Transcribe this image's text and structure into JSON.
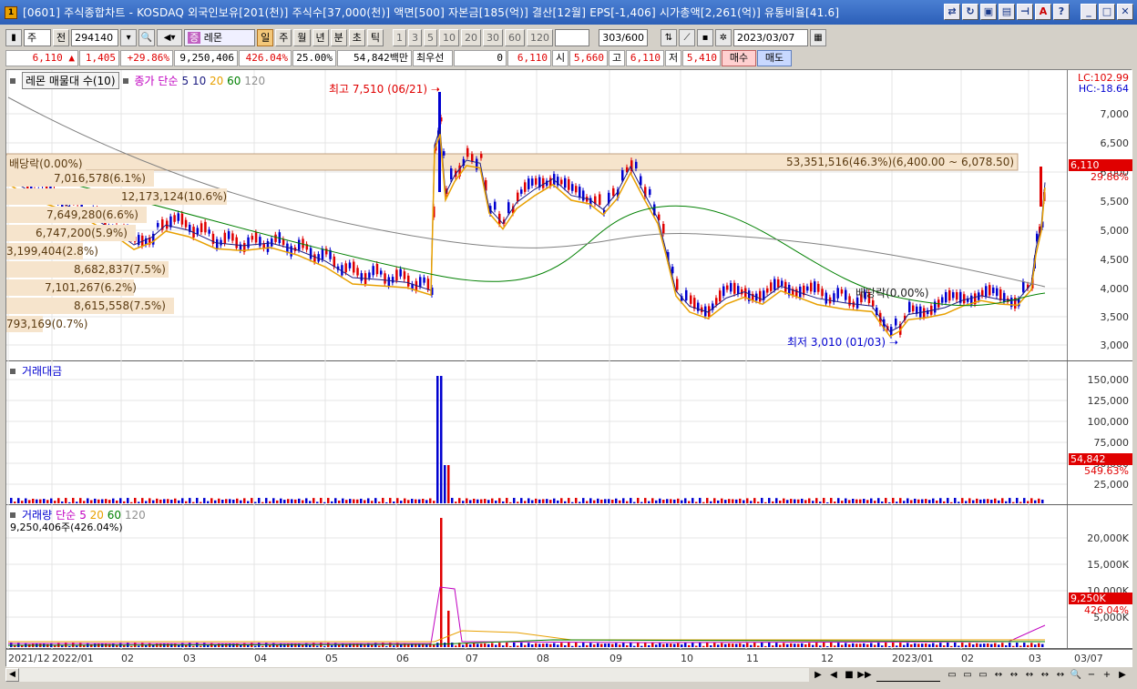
{
  "window": {
    "title": "[0601] 주식종합차트 - KOSDAQ 외국인보유[201(천)] 주식수[37,000(천)] 액면[500] 자본금[185(억)] 결산[12월] EPS[-1,406] 시가총액[2,261(억)] 유통비율[41.6]",
    "icon_text": "1"
  },
  "toolbar": {
    "market": "주",
    "prev_label": "전",
    "code": "294140",
    "stock_name": "레몬",
    "periods": [
      "일",
      "주",
      "월",
      "년",
      "분",
      "초",
      "틱"
    ],
    "intervals": [
      "1",
      "3",
      "5",
      "10",
      "20",
      "30",
      "60",
      "120"
    ],
    "count": "303",
    "count_total": "/600",
    "date": "2023/03/07"
  },
  "price_row": {
    "price": "6,110",
    "change": "1,405",
    "change_pct": "+29.86%",
    "volume": "9,250,406",
    "volume_pct": "426.04%",
    "rate": "25.00%",
    "amount": "54,842백만",
    "priority": "최우선",
    "priority_val": "0",
    "best_price": "6,110",
    "open_label": "시",
    "open": "5,660",
    "high_label": "고",
    "high": "6,110",
    "low_label": "저",
    "low": "5,410",
    "buy_label": "매수",
    "sell_label": "매도"
  },
  "price_pane": {
    "legend_box": "레몬 매물대 수(10)",
    "legend_ma": "종가 단순",
    "ma_periods": [
      "5",
      "10",
      "20",
      "60",
      "120"
    ],
    "ma_colors": [
      "#1a1a80",
      "#1a1a80",
      "#e8a000",
      "#008000",
      "#808080"
    ],
    "lc_label": "LC:102.99",
    "hc_label": "HC:-18.64",
    "y_ticks": [
      "7,000",
      "6,500",
      "6,000",
      "5,500",
      "5,000",
      "4,500",
      "4,000",
      "3,500",
      "3,000"
    ],
    "current_price": "6,110",
    "current_pct": "29.86%",
    "high_annot": "최고 7,510 (06/21)",
    "low_annot": "최저 3,010 (01/03)",
    "dividend_label_1": "배당락(0.00%)",
    "dividend_label_2": "배당락(0.00%)",
    "volume_profile": [
      "7,016,578(6.1%)",
      "12,173,124(10.6%)",
      "7,649,280(6.6%)",
      "6,747,200(5.9%)",
      "3,199,404(2.8%)",
      "8,682,837(7.5%)",
      "7,101,267(6.2%)",
      "8,615,558(7.5%)",
      "793,169(0.7%)"
    ],
    "highlight_band": "53,351,516(46.3%)(6,400.00 ~ 6,078.50)"
  },
  "amount_pane": {
    "legend": "거래대금",
    "y_ticks": [
      "150,000",
      "125,000",
      "100,000",
      "75,000",
      "50,000",
      "25,000"
    ],
    "current": "54,842",
    "current_pct": "549.63%"
  },
  "volume_pane": {
    "legend": "거래량",
    "legend_ma": "단순",
    "ma_periods": [
      "5",
      "20",
      "60",
      "120"
    ],
    "ma_colors": [
      "#c000c0",
      "#e8a000",
      "#008000",
      "#808080"
    ],
    "current_text": "9,250,406주(426.04%)",
    "y_ticks": [
      "20,000K",
      "15,000K",
      "10,000K",
      "5,000K"
    ],
    "current": "9,250K",
    "current_pct": "426.04%"
  },
  "x_axis": [
    "2021/12",
    "2022/01",
    "02",
    "03",
    "04",
    "05",
    "06",
    "07",
    "08",
    "09",
    "10",
    "11",
    "12",
    "2023/01",
    "02",
    "03",
    "03/07"
  ]
}
